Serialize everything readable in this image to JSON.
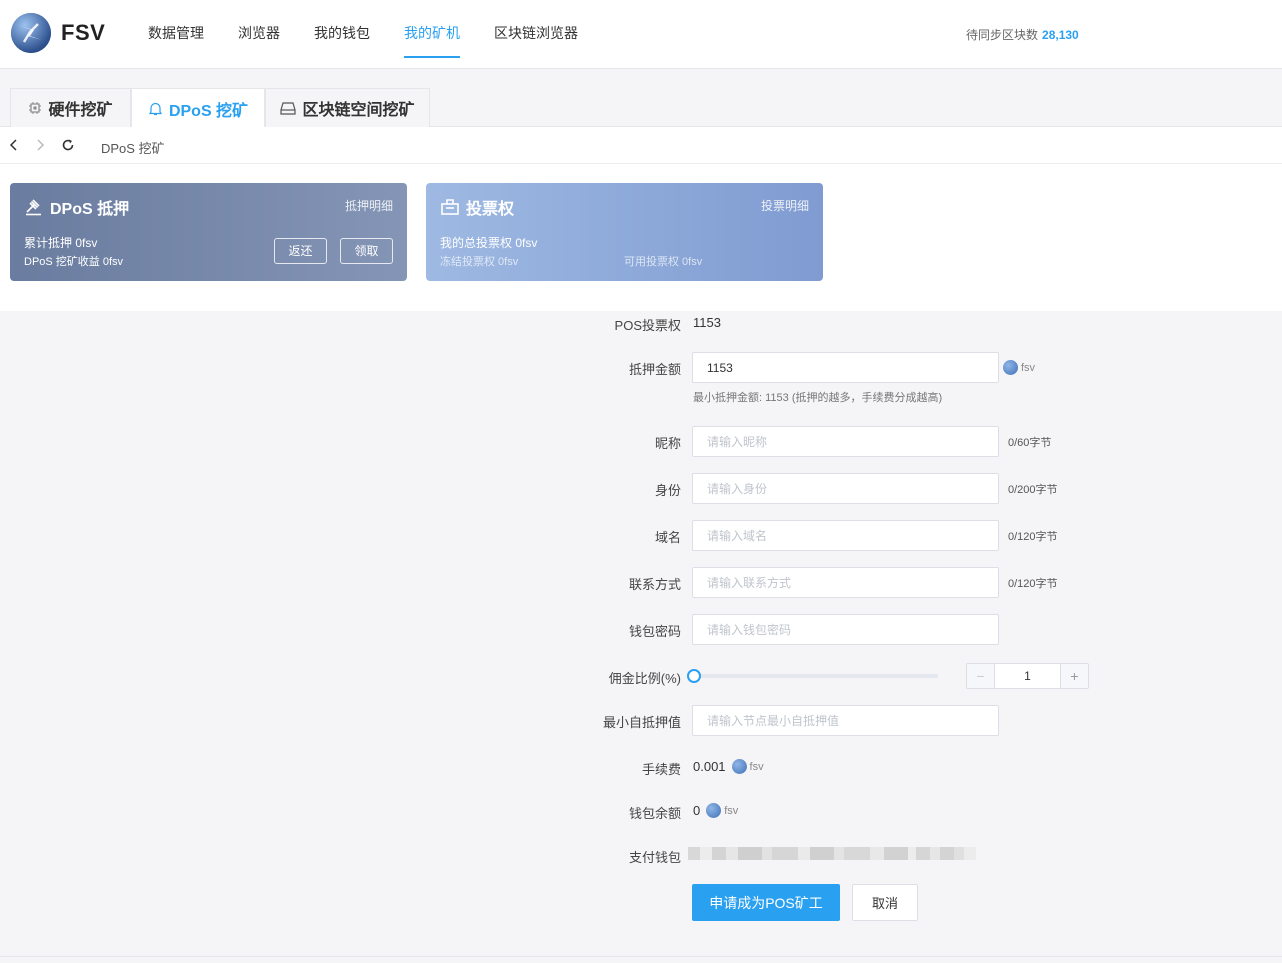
{
  "brand": {
    "name": "FSV"
  },
  "nav": {
    "items": [
      {
        "label": "数据管理",
        "active": false
      },
      {
        "label": "浏览器",
        "active": false
      },
      {
        "label": "我的钱包",
        "active": false
      },
      {
        "label": "我的矿机",
        "active": true
      },
      {
        "label": "区块链浏览器",
        "active": false
      }
    ],
    "sync_label": "待同步区块数",
    "sync_value": "28,130"
  },
  "tabs": [
    {
      "label": "硬件挖矿",
      "icon": "chip-icon",
      "active": false
    },
    {
      "label": "DPoS 挖矿",
      "icon": "bell-icon",
      "active": true
    },
    {
      "label": "区块链空间挖矿",
      "icon": "drive-icon",
      "active": false
    }
  ],
  "breadcrumb": {
    "path": "DPoS 挖矿"
  },
  "card_pledge": {
    "title": "DPoS 抵押",
    "link": "抵押明细",
    "total": "累计抵押 0fsv",
    "earnings": "DPoS 挖矿收益 0fsv",
    "return_btn": "返还",
    "claim_btn": "领取"
  },
  "card_vote": {
    "title": "投票权",
    "link": "投票明细",
    "total": "我的总投票权 0fsv",
    "frozen": "冻结投票权 0fsv",
    "available": "可用投票权 0fsv"
  },
  "form": {
    "pos_vote_label": "POS投票权",
    "pos_vote_value": "1153",
    "pledge_label": "抵押金额",
    "pledge_value": "1153",
    "coin_unit": "fsv",
    "pledge_hint": "最小抵押金额: 1153 (抵押的越多，手续费分成越高)",
    "nickname_label": "昵称",
    "nickname_placeholder": "请输入昵称",
    "nickname_counter": "0/60字节",
    "identity_label": "身份",
    "identity_placeholder": "请输入身份",
    "identity_counter": "0/200字节",
    "domain_label": "域名",
    "domain_placeholder": "请输入域名",
    "domain_counter": "0/120字节",
    "contact_label": "联系方式",
    "contact_placeholder": "请输入联系方式",
    "contact_counter": "0/120字节",
    "password_label": "钱包密码",
    "password_placeholder": "请输入钱包密码",
    "commission_label": "佣金比例(%)",
    "commission_value": "1",
    "commission_max": 100,
    "min_self_label": "最小自抵押值",
    "min_self_placeholder": "请输入节点最小自抵押值",
    "fee_label": "手续费",
    "fee_value": "0.001",
    "balance_label": "钱包余额",
    "balance_value": "0",
    "pay_wallet_label": "支付钱包",
    "submit_btn": "申请成为POS矿工",
    "cancel_btn": "取消"
  },
  "colors": {
    "accent": "#2aa0f0",
    "card_pledge": "#6a7c9f",
    "card_vote": "#9eb9e2"
  }
}
